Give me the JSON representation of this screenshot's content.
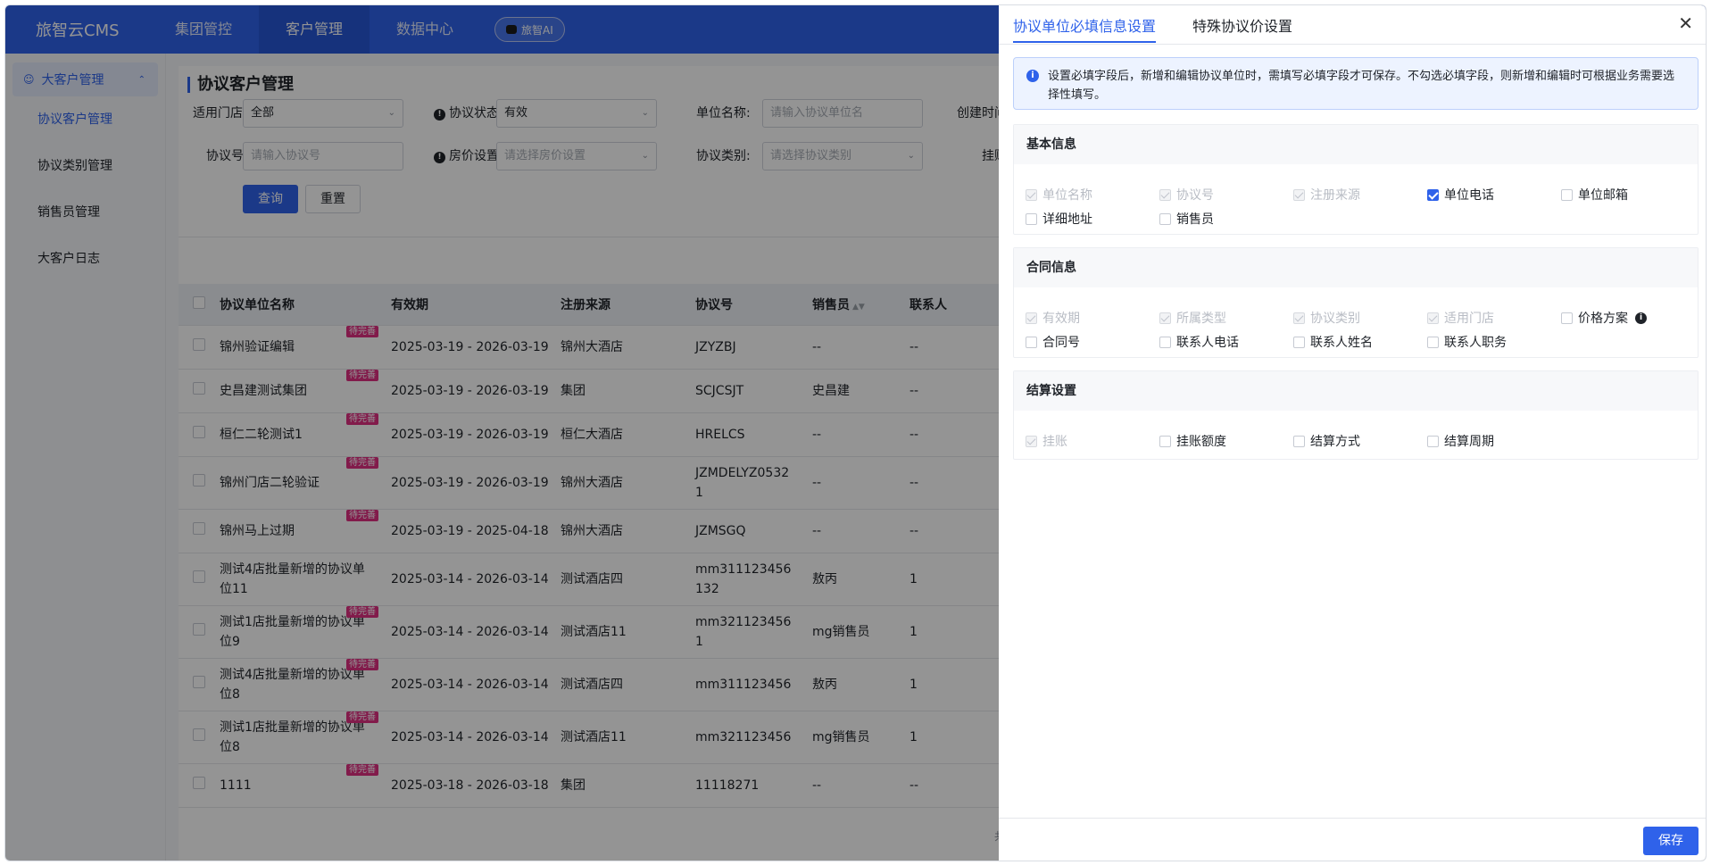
{
  "app": {
    "title": "旅智云CMS"
  },
  "topnav": {
    "items": [
      "集团管控",
      "客户管理",
      "数据中心"
    ],
    "ai_label": "旅智AI"
  },
  "sidebar": {
    "group": "大客户管理",
    "items": [
      "协议客户管理",
      "协议类别管理",
      "销售员管理",
      "大客户日志"
    ]
  },
  "page": {
    "title": "协议客户管理"
  },
  "filters": {
    "store_label": "适用门店:",
    "store_value": "全部",
    "status_label": "协议状态:",
    "status_value": "有效",
    "unit_label": "单位名称:",
    "unit_placeholder": "请输入协议单位名",
    "created_label": "创建时间",
    "agreement_no_label": "协议号:",
    "agreement_no_placeholder": "请输入协议号",
    "price_label": "房价设置:",
    "price_placeholder": "请选择房价设置",
    "category_label": "协议类别:",
    "category_placeholder": "请选择协议类别",
    "hang_label": "挂账",
    "query_button": "查询",
    "reset_button": "重置"
  },
  "table": {
    "columns": [
      "协议单位名称",
      "有效期",
      "注册来源",
      "协议号",
      "销售员",
      "联系人"
    ],
    "tag": "待完善",
    "rows": [
      {
        "name": "锦州验证编辑",
        "period": "2025-03-19 - 2026-03-19",
        "source": "锦州大酒店",
        "no": "JZYZBJ",
        "sales": "--",
        "contact": "--"
      },
      {
        "name": "史昌建测试集团",
        "period": "2025-03-19 - 2026-03-19",
        "source": "集团",
        "no": "SCJCSJT",
        "sales": "史昌建",
        "contact": "--"
      },
      {
        "name": "桓仁二轮测试1",
        "period": "2025-03-19 - 2026-03-19",
        "source": "桓仁大酒店",
        "no": "HRELCS",
        "sales": "--",
        "contact": "--"
      },
      {
        "name": "锦州门店二轮验证",
        "period": "2025-03-19 - 2026-03-19",
        "source": "锦州大酒店",
        "no": "JZMDELYZ05321",
        "sales": "--",
        "contact": "--"
      },
      {
        "name": "锦州马上过期",
        "period": "2025-03-19 - 2025-04-18",
        "source": "锦州大酒店",
        "no": "JZMSGQ",
        "sales": "--",
        "contact": "--"
      },
      {
        "name": "测试4店批量新增的协议单位11",
        "period": "2025-03-14 - 2026-03-14",
        "source": "测试酒店四",
        "no": "mm311123456132",
        "sales": "敖丙",
        "contact": "1"
      },
      {
        "name": "测试1店批量新增的协议单位9",
        "period": "2025-03-14 - 2026-03-14",
        "source": "测试酒店11",
        "no": "mm3211234561",
        "sales": "mg销售员",
        "contact": "1"
      },
      {
        "name": "测试4店批量新增的协议单位8",
        "period": "2025-03-14 - 2026-03-14",
        "source": "测试酒店四",
        "no": "mm311123456",
        "sales": "敖丙",
        "contact": "1"
      },
      {
        "name": "测试1店批量新增的协议单位8",
        "period": "2025-03-14 - 2026-03-14",
        "source": "测试酒店11",
        "no": "mm321123456",
        "sales": "mg销售员",
        "contact": "1"
      },
      {
        "name": "1111",
        "period": "2025-03-18 - 2026-03-18",
        "source": "集团",
        "no": "11118271",
        "sales": "--",
        "contact": "--"
      }
    ]
  },
  "drawer": {
    "tab_required": "协议单位必填信息设置",
    "tab_special": "特殊协议价设置",
    "notice": "设置必填字段后，新增和编辑协议单位时，需填写必填字段才可保存。不勾选必填字段，则新增和编辑时可根据业务需要选择性填写。",
    "sections": [
      {
        "title": "基本信息",
        "options": [
          {
            "label": "单位名称",
            "state": "disabled"
          },
          {
            "label": "协议号",
            "state": "disabled"
          },
          {
            "label": "注册来源",
            "state": "disabled"
          },
          {
            "label": "单位电话",
            "state": "checked"
          },
          {
            "label": "单位邮箱",
            "state": "unchecked"
          },
          {
            "label": "详细地址",
            "state": "unchecked"
          },
          {
            "label": "销售员",
            "state": "unchecked"
          }
        ]
      },
      {
        "title": "合同信息",
        "options": [
          {
            "label": "有效期",
            "state": "disabled"
          },
          {
            "label": "所属类型",
            "state": "disabled"
          },
          {
            "label": "协议类别",
            "state": "disabled"
          },
          {
            "label": "适用门店",
            "state": "disabled"
          },
          {
            "label": "价格方案",
            "state": "unchecked"
          },
          {
            "label": "合同号",
            "state": "unchecked"
          },
          {
            "label": "联系人电话",
            "state": "unchecked"
          },
          {
            "label": "联系人姓名",
            "state": "unchecked"
          },
          {
            "label": "联系人职务",
            "state": "unchecked"
          }
        ]
      },
      {
        "title": "结算设置",
        "options": [
          {
            "label": "挂账",
            "state": "disabled"
          },
          {
            "label": "挂账额度",
            "state": "unchecked"
          },
          {
            "label": "结算方式",
            "state": "unchecked"
          },
          {
            "label": "结算周期",
            "state": "unchecked"
          }
        ]
      }
    ],
    "save_button": "保存"
  },
  "pagination_partial": "共",
  "colors": {
    "primary": "#2f62ea",
    "tag": "#e02f82",
    "mask": "rgba(0,0,0,0.42)"
  }
}
